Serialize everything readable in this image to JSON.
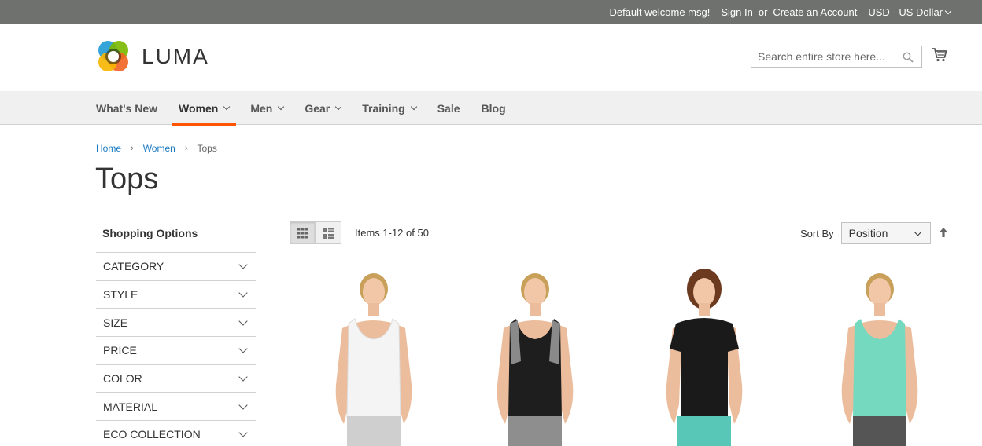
{
  "topbar": {
    "welcome": "Default welcome msg!",
    "sign_in": "Sign In",
    "or": "or",
    "create_account": "Create an Account",
    "currency": "USD - US Dollar"
  },
  "header": {
    "logo_text": "LUMA",
    "search_placeholder": "Search entire store here...",
    "search_icon": "search-icon",
    "cart_icon": "cart-icon"
  },
  "nav": {
    "items": [
      {
        "label": "What's New",
        "has_dropdown": false
      },
      {
        "label": "Women",
        "has_dropdown": true,
        "active": true
      },
      {
        "label": "Men",
        "has_dropdown": true
      },
      {
        "label": "Gear",
        "has_dropdown": true
      },
      {
        "label": "Training",
        "has_dropdown": true
      },
      {
        "label": "Sale",
        "has_dropdown": false
      },
      {
        "label": "Blog",
        "has_dropdown": false
      }
    ]
  },
  "breadcrumb": {
    "items": [
      "Home",
      "Women",
      "Tops"
    ]
  },
  "page": {
    "title": "Tops"
  },
  "sidebar": {
    "title": "Shopping Options",
    "filters": [
      "CATEGORY",
      "STYLE",
      "SIZE",
      "PRICE",
      "COLOR",
      "MATERIAL",
      "ECO COLLECTION"
    ]
  },
  "toolbar": {
    "view_modes": [
      "grid-icon",
      "list-icon"
    ],
    "amount": "Items 1-12 of 50",
    "sort_label": "Sort By",
    "sort_value": "Position",
    "sort_direction_icon": "arrow-up-icon"
  },
  "products": [
    {
      "image": "white-tank-top",
      "top_color": "#f4f4f4",
      "bottom_color": "#cfcfcf"
    },
    {
      "image": "black-grey-tank-top",
      "top_color": "#1e1e1e",
      "bottom_color": "#8e8e8e"
    },
    {
      "image": "black-tee",
      "top_color": "#1a1a1a",
      "bottom_color": "#58c7b7"
    },
    {
      "image": "mint-tank-top",
      "top_color": "#74d9bf",
      "bottom_color": "#555555"
    }
  ],
  "colors": {
    "topbar_bg": "#6e716e",
    "nav_bg": "#f0f0f0",
    "nav_active_underline": "#ff5501",
    "link": "#1979c3"
  }
}
